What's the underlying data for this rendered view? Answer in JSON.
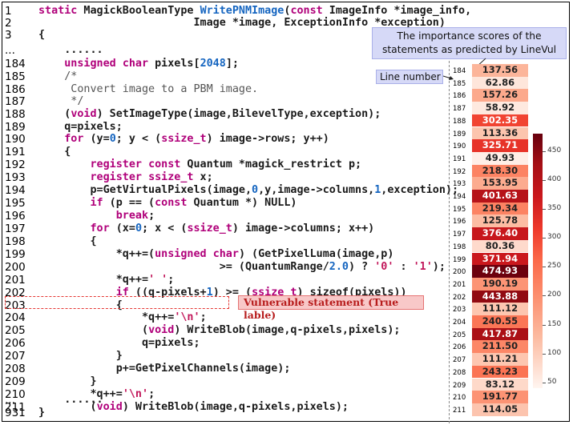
{
  "code_lines": [
    {
      "ln": "1",
      "html_key": "l1"
    },
    {
      "ln": "2",
      "html_key": "l2"
    },
    {
      "ln": "3",
      "html_key": "l3"
    },
    {
      "ln": "...",
      "html_key": "l4"
    },
    {
      "ln": "184",
      "html_key": "l184"
    },
    {
      "ln": "185",
      "html_key": "l185"
    },
    {
      "ln": "186",
      "html_key": "l186"
    },
    {
      "ln": "187",
      "html_key": "l187"
    },
    {
      "ln": "188",
      "html_key": "l188"
    },
    {
      "ln": "189",
      "html_key": "l189"
    },
    {
      "ln": "190",
      "html_key": "l190"
    },
    {
      "ln": "191",
      "html_key": "l191"
    },
    {
      "ln": "192",
      "html_key": "l192"
    },
    {
      "ln": "193",
      "html_key": "l193"
    },
    {
      "ln": "194",
      "html_key": "l194"
    },
    {
      "ln": "195",
      "html_key": "l195"
    },
    {
      "ln": "196",
      "html_key": "l196"
    },
    {
      "ln": "197",
      "html_key": "l197"
    },
    {
      "ln": "198",
      "html_key": "l198"
    },
    {
      "ln": "199",
      "html_key": "l199"
    },
    {
      "ln": "200",
      "html_key": "l200"
    },
    {
      "ln": "201",
      "html_key": "l201"
    },
    {
      "ln": "202",
      "html_key": "l202"
    },
    {
      "ln": "203",
      "html_key": "l203"
    },
    {
      "ln": "204",
      "html_key": "l204"
    },
    {
      "ln": "205",
      "html_key": "l205"
    },
    {
      "ln": "206",
      "html_key": "l206"
    },
    {
      "ln": "207",
      "html_key": "l207"
    },
    {
      "ln": "208",
      "html_key": "l208"
    },
    {
      "ln": "209",
      "html_key": "l209"
    },
    {
      "ln": "210",
      "html_key": "l210"
    },
    {
      "ln": "211",
      "html_key": "l211"
    },
    {
      "ln": "...",
      "html_key": "l212"
    },
    {
      "ln": "931",
      "html_key": "l931"
    }
  ],
  "code_text": {
    "l1": "static MagickBooleanType WritePNMImage(const ImageInfo *image_info,",
    "l2": "                        Image *image, ExceptionInfo *exception)",
    "l3": "{",
    "l4": "    ......",
    "l184": "    unsigned char pixels[2048];",
    "l185": "    /*",
    "l186": "     Convert image to a PBM image.",
    "l187": "     */",
    "l188": "    (void) SetImageType(image,BilevelType,exception);",
    "l189": "    q=pixels;",
    "l190": "    for (y=0; y < (ssize_t) image->rows; y++)",
    "l191": "    {",
    "l192": "        register const Quantum *magick_restrict p;",
    "l193": "        register ssize_t x;",
    "l194": "        p=GetVirtualPixels(image,0,y,image->columns,1,exception);",
    "l195": "        if (p == (const Quantum *) NULL)",
    "l196": "            break;",
    "l197": "        for (x=0; x < (ssize_t) image->columns; x++)",
    "l198": "        {",
    "l199": "            *q++=(unsigned char) (GetPixelLuma(image,p)",
    "l200": "                            >= (QuantumRange/2.0) ? '0' : '1');",
    "l201": "            *q++=' ';",
    "l202": "            if ((q-pixels+1) >= (ssize_t) sizeof(pixels))",
    "l203": "            {",
    "l204": "                *q++='\\n';",
    "l205": "                (void) WriteBlob(image,q-pixels,pixels);",
    "l206": "                q=pixels;",
    "l207": "            }",
    "l208": "            p+=GetPixelChannels(image);",
    "l209": "        }",
    "l210": "        *q++='\\n';",
    "l211": "        (void) WriteBlob(image,q-pixels,pixels);",
    "l212": "    ......",
    "l931": "}"
  },
  "annotations": {
    "importance_note": "The importance scores of the statements as predicted by LineVul",
    "line_number_note": "Line number",
    "vulnerable_label": "Vulnerable statement (True lable)"
  },
  "heatmap": {
    "lines": [
      "184",
      "185",
      "186",
      "187",
      "188",
      "189",
      "190",
      "191",
      "192",
      "193",
      "194",
      "195",
      "196",
      "197",
      "198",
      "199",
      "200",
      "201",
      "202",
      "203",
      "204",
      "205",
      "206",
      "207",
      "208",
      "209",
      "210",
      "211"
    ],
    "scores": [
      "137.56",
      "62.86",
      "157.26",
      "58.92",
      "302.35",
      "113.36",
      "325.71",
      "49.93",
      "218.30",
      "153.95",
      "401.63",
      "219.34",
      "125.78",
      "376.40",
      "80.36",
      "371.94",
      "474.93",
      "190.19",
      "443.88",
      "111.12",
      "240.55",
      "417.87",
      "211.50",
      "111.21",
      "243.23",
      "83.12",
      "191.77",
      "114.05"
    ],
    "colorbar_ticks": [
      "450",
      "400",
      "350",
      "300",
      "250",
      "200",
      "150",
      "100",
      "50"
    ],
    "colorbar_range": [
      40,
      480
    ]
  }
}
